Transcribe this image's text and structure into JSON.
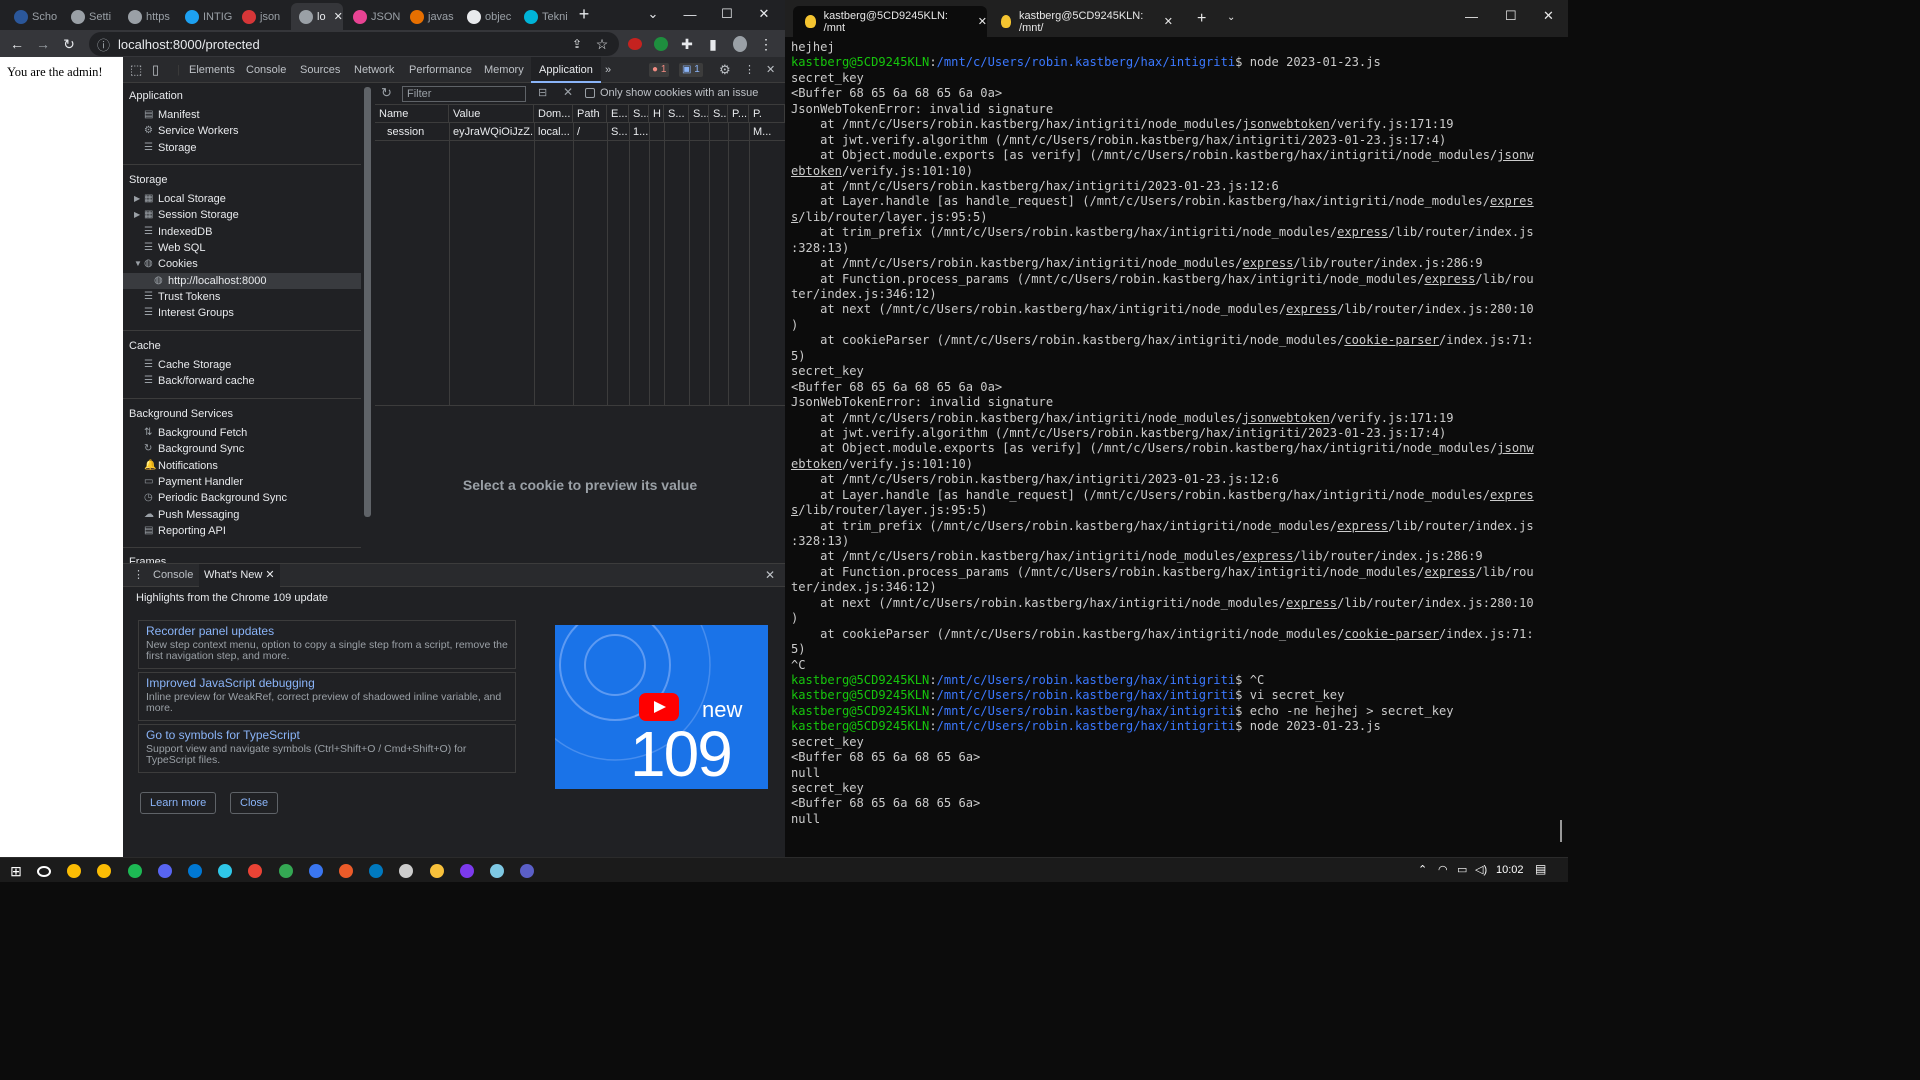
{
  "chrome": {
    "tabs": [
      {
        "label": "Scho",
        "color": "#2b579a"
      },
      {
        "label": "Setti",
        "color": "#9aa0a6"
      },
      {
        "label": "https",
        "color": "#9aa0a6"
      },
      {
        "label": "INTIG",
        "color": "#1da1f2"
      },
      {
        "label": "json",
        "color": "#d63638"
      },
      {
        "label": "lo",
        "color": "#9aa0a6",
        "active": true
      },
      {
        "label": "JSON",
        "color": "#e84393"
      },
      {
        "label": "javas",
        "color": "#e76f00"
      },
      {
        "label": "objec",
        "color": "#e8eaed"
      },
      {
        "label": "Tekni",
        "color": "#00b4d8"
      }
    ],
    "new_tab": "+",
    "address": "localhost:8000/protected"
  },
  "page": {
    "text": "You are the admin!"
  },
  "devtools": {
    "tabs": [
      "Elements",
      "Console",
      "Sources",
      "Network",
      "Performance",
      "Memory",
      "Application"
    ],
    "active_tab": "Application",
    "more_tabs": "»",
    "errors": "1",
    "messages": "1",
    "sidebar": {
      "application_header": "Application",
      "application_items": [
        "Manifest",
        "Service Workers",
        "Storage"
      ],
      "storage_header": "Storage",
      "storage_items": [
        "Local Storage",
        "Session Storage",
        "IndexedDB",
        "Web SQL",
        "Cookies"
      ],
      "cookie_origin": "http://localhost:8000",
      "storage_items_after": [
        "Trust Tokens",
        "Interest Groups"
      ],
      "cache_header": "Cache",
      "cache_items": [
        "Cache Storage",
        "Back/forward cache"
      ],
      "bg_header": "Background Services",
      "bg_items": [
        "Background Fetch",
        "Background Sync",
        "Notifications",
        "Payment Handler",
        "Periodic Background Sync",
        "Push Messaging",
        "Reporting API"
      ],
      "frames_header": "Frames"
    },
    "cookies": {
      "filter_placeholder": "Filter",
      "only_issue_label": "Only show cookies with an issue",
      "columns": [
        "Name",
        "Value",
        "Dom...",
        "Path",
        "E...",
        "S...",
        "H",
        "S...",
        "S...",
        "S...",
        "P...",
        "P."
      ],
      "row": [
        "session",
        "eyJraWQiOiJzZ...",
        "local...",
        "/",
        "S...",
        "1...",
        "",
        "",
        "",
        "",
        "",
        "M..."
      ],
      "preview_empty": "Select a cookie to preview its value"
    },
    "drawer": {
      "tabs": [
        "Console",
        "What's New"
      ],
      "headline": "Highlights from the Chrome 109 update",
      "cards": [
        {
          "title": "Recorder panel updates",
          "desc": "New step context menu, option to copy a single step from a script, remove the first navigation step, and more."
        },
        {
          "title": "Improved JavaScript debugging",
          "desc": "Inline preview for WeakRef, correct preview of shadowed inline variable, and more."
        },
        {
          "title": "Go to symbols for TypeScript",
          "desc": "Support view and navigate symbols (Ctrl+Shift+O / Cmd+Shift+O) for TypeScript files."
        }
      ],
      "learn_more": "Learn more",
      "close": "Close",
      "image_word": "new",
      "image_version": "109"
    }
  },
  "terminal": {
    "tabs": [
      "kastberg@5CD9245KLN: /mnt",
      "kastberg@5CD9245KLN: /mnt/"
    ],
    "lines": [
      [
        {
          "t": "hejhej"
        }
      ],
      [
        {
          "t": "kastberg@5CD9245KLN",
          "c": "pu"
        },
        {
          "t": ":"
        },
        {
          "t": "/mnt/c/Users/robin.kastberg/hax/intigriti",
          "c": "pp"
        },
        {
          "t": "$ node 2023-01-23.js"
        }
      ],
      [
        {
          "t": "secret_key"
        }
      ],
      [
        {
          "t": "<Buffer 68 65 6a 68 65 6a 0a>"
        }
      ],
      [
        {
          "t": "JsonWebTokenError: invalid signature"
        }
      ],
      [
        {
          "t": "    at /mnt/c/Users/robin.kastberg/hax/intigriti/node_modules/"
        },
        {
          "t": "jsonwebtoken",
          "c": "ul"
        },
        {
          "t": "/verify.js:171:19"
        }
      ],
      [
        {
          "t": "    at jwt.verify.algorithm (/mnt/c/Users/robin.kastberg/hax/intigriti/2023-01-23.js:17:4)"
        }
      ],
      [
        {
          "t": "    at Object.module.exports [as verify] (/mnt/c/Users/robin.kastberg/hax/intigriti/node_modules/"
        },
        {
          "t": "jsonw",
          "c": "ul"
        }
      ],
      [
        {
          "t": "ebtoken",
          "c": "ul"
        },
        {
          "t": "/verify.js:101:10)"
        }
      ],
      [
        {
          "t": "    at /mnt/c/Users/robin.kastberg/hax/intigriti/2023-01-23.js:12:6"
        }
      ],
      [
        {
          "t": "    at Layer.handle [as handle_request] (/mnt/c/Users/robin.kastberg/hax/intigriti/node_modules/"
        },
        {
          "t": "expres",
          "c": "ul"
        }
      ],
      [
        {
          "t": "s",
          "c": "ul"
        },
        {
          "t": "/lib/router/layer.js:95:5)"
        }
      ],
      [
        {
          "t": "    at trim_prefix (/mnt/c/Users/robin.kastberg/hax/intigriti/node_modules/"
        },
        {
          "t": "express",
          "c": "ul"
        },
        {
          "t": "/lib/router/index.js"
        }
      ],
      [
        {
          "t": ":328:13)"
        }
      ],
      [
        {
          "t": "    at /mnt/c/Users/robin.kastberg/hax/intigriti/node_modules/"
        },
        {
          "t": "express",
          "c": "ul"
        },
        {
          "t": "/lib/router/index.js:286:9"
        }
      ],
      [
        {
          "t": "    at Function.process_params (/mnt/c/Users/robin.kastberg/hax/intigriti/node_modules/"
        },
        {
          "t": "express",
          "c": "ul"
        },
        {
          "t": "/lib/rou"
        }
      ],
      [
        {
          "t": "ter/index.js:346:12)"
        }
      ],
      [
        {
          "t": "    at next (/mnt/c/Users/robin.kastberg/hax/intigriti/node_modules/"
        },
        {
          "t": "express",
          "c": "ul"
        },
        {
          "t": "/lib/router/index.js:280:10"
        }
      ],
      [
        {
          "t": ")"
        }
      ],
      [
        {
          "t": "    at cookieParser (/mnt/c/Users/robin.kastberg/hax/intigriti/node_modules/"
        },
        {
          "t": "cookie-parser",
          "c": "ul"
        },
        {
          "t": "/index.js:71:"
        }
      ],
      [
        {
          "t": "5)"
        }
      ],
      [
        {
          "t": "secret_key"
        }
      ],
      [
        {
          "t": "<Buffer 68 65 6a 68 65 6a 0a>"
        }
      ],
      [
        {
          "t": "JsonWebTokenError: invalid signature"
        }
      ],
      [
        {
          "t": "    at /mnt/c/Users/robin.kastberg/hax/intigriti/node_modules/"
        },
        {
          "t": "jsonwebtoken",
          "c": "ul"
        },
        {
          "t": "/verify.js:171:19"
        }
      ],
      [
        {
          "t": "    at jwt.verify.algorithm (/mnt/c/Users/robin.kastberg/hax/intigriti/2023-01-23.js:17:4)"
        }
      ],
      [
        {
          "t": "    at Object.module.exports [as verify] (/mnt/c/Users/robin.kastberg/hax/intigriti/node_modules/"
        },
        {
          "t": "jsonw",
          "c": "ul"
        }
      ],
      [
        {
          "t": "ebtoken",
          "c": "ul"
        },
        {
          "t": "/verify.js:101:10)"
        }
      ],
      [
        {
          "t": "    at /mnt/c/Users/robin.kastberg/hax/intigriti/2023-01-23.js:12:6"
        }
      ],
      [
        {
          "t": "    at Layer.handle [as handle_request] (/mnt/c/Users/robin.kastberg/hax/intigriti/node_modules/"
        },
        {
          "t": "expres",
          "c": "ul"
        }
      ],
      [
        {
          "t": "s",
          "c": "ul"
        },
        {
          "t": "/lib/router/layer.js:95:5)"
        }
      ],
      [
        {
          "t": "    at trim_prefix (/mnt/c/Users/robin.kastberg/hax/intigriti/node_modules/"
        },
        {
          "t": "express",
          "c": "ul"
        },
        {
          "t": "/lib/router/index.js"
        }
      ],
      [
        {
          "t": ":328:13)"
        }
      ],
      [
        {
          "t": "    at /mnt/c/Users/robin.kastberg/hax/intigriti/node_modules/"
        },
        {
          "t": "express",
          "c": "ul"
        },
        {
          "t": "/lib/router/index.js:286:9"
        }
      ],
      [
        {
          "t": "    at Function.process_params (/mnt/c/Users/robin.kastberg/hax/intigriti/node_modules/"
        },
        {
          "t": "express",
          "c": "ul"
        },
        {
          "t": "/lib/rou"
        }
      ],
      [
        {
          "t": "ter/index.js:346:12)"
        }
      ],
      [
        {
          "t": "    at next (/mnt/c/Users/robin.kastberg/hax/intigriti/node_modules/"
        },
        {
          "t": "express",
          "c": "ul"
        },
        {
          "t": "/lib/router/index.js:280:10"
        }
      ],
      [
        {
          "t": ")"
        }
      ],
      [
        {
          "t": "    at cookieParser (/mnt/c/Users/robin.kastberg/hax/intigriti/node_modules/"
        },
        {
          "t": "cookie-parser",
          "c": "ul"
        },
        {
          "t": "/index.js:71:"
        }
      ],
      [
        {
          "t": "5)"
        }
      ],
      [
        {
          "t": "^C"
        }
      ],
      [
        {
          "t": "kastberg@5CD9245KLN",
          "c": "pu"
        },
        {
          "t": ":"
        },
        {
          "t": "/mnt/c/Users/robin.kastberg/hax/intigriti",
          "c": "pp"
        },
        {
          "t": "$ ^C"
        }
      ],
      [
        {
          "t": "kastberg@5CD9245KLN",
          "c": "pu"
        },
        {
          "t": ":"
        },
        {
          "t": "/mnt/c/Users/robin.kastberg/hax/intigriti",
          "c": "pp"
        },
        {
          "t": "$ vi secret_key"
        }
      ],
      [
        {
          "t": "kastberg@5CD9245KLN",
          "c": "pu"
        },
        {
          "t": ":"
        },
        {
          "t": "/mnt/c/Users/robin.kastberg/hax/intigriti",
          "c": "pp"
        },
        {
          "t": "$ echo -ne hejhej > secret_key"
        }
      ],
      [
        {
          "t": "kastberg@5CD9245KLN",
          "c": "pu"
        },
        {
          "t": ":"
        },
        {
          "t": "/mnt/c/Users/robin.kastberg/hax/intigriti",
          "c": "pp"
        },
        {
          "t": "$ node 2023-01-23.js"
        }
      ],
      [
        {
          "t": "secret_key"
        }
      ],
      [
        {
          "t": "<Buffer 68 65 6a 68 65 6a>"
        }
      ],
      [
        {
          "t": "null"
        }
      ],
      [
        {
          "t": "secret_key"
        }
      ],
      [
        {
          "t": "<Buffer 68 65 6a 68 65 6a>"
        }
      ],
      [
        {
          "t": "null"
        }
      ]
    ]
  },
  "taskbar": {
    "apps": [
      {
        "name": "search",
        "color": "#ffffff"
      },
      {
        "name": "chrome",
        "color": "#fbbc04"
      },
      {
        "name": "chrome-2",
        "color": "#fbbc04"
      },
      {
        "name": "spotify",
        "color": "#1db954"
      },
      {
        "name": "discord",
        "color": "#5865f2"
      },
      {
        "name": "outlook",
        "color": "#0078d4"
      },
      {
        "name": "edge",
        "color": "#2fc7e8"
      },
      {
        "name": "gmail",
        "color": "#ea4335"
      },
      {
        "name": "drive",
        "color": "#34a853"
      },
      {
        "name": "signal",
        "color": "#3a76f0"
      },
      {
        "name": "office",
        "color": "#eb5b29"
      },
      {
        "name": "trello",
        "color": "#0079bf"
      },
      {
        "name": "terminal",
        "color": "#cccccc"
      },
      {
        "name": "explorer",
        "color": "#f8c13b"
      },
      {
        "name": "obsidian",
        "color": "#7c3aed"
      },
      {
        "name": "notepad",
        "color": "#7ec8e3"
      },
      {
        "name": "teams",
        "color": "#5b5fc7"
      }
    ],
    "clock": "10:02"
  }
}
